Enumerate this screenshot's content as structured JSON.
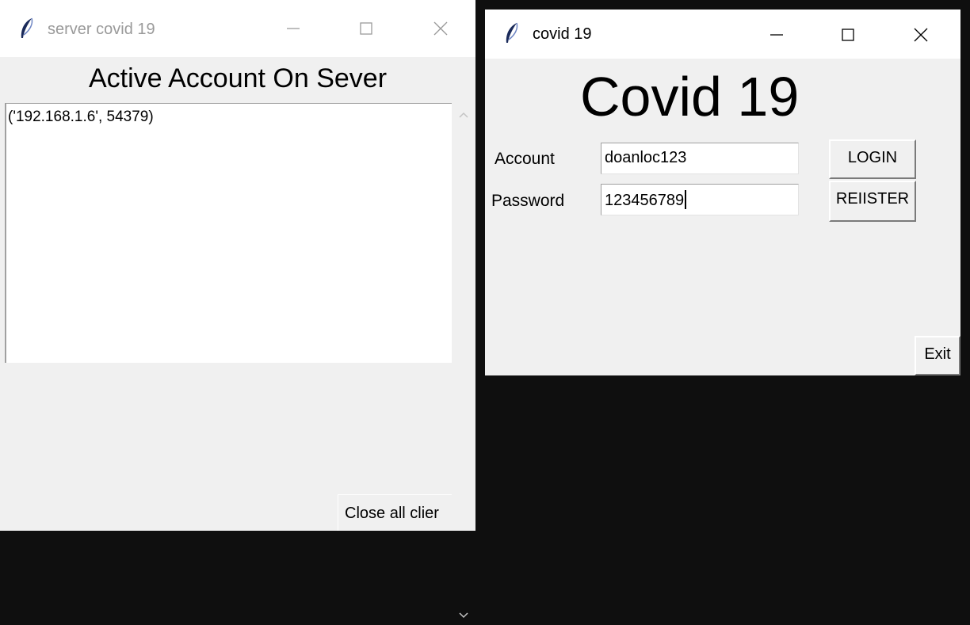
{
  "server_window": {
    "title": "server covid 19",
    "heading": "Active Account On Sever",
    "clients": [
      "('192.168.1.6', 54379)"
    ],
    "close_all_label": "Close all clier"
  },
  "client_window": {
    "title": "covid 19",
    "heading": "Covid 19",
    "account_label": "Account",
    "account_value": "doanloc123",
    "password_label": "Password",
    "password_value": "123456789",
    "login_label": "LOGIN",
    "register_label": "REIISTER",
    "exit_label": "Exit"
  },
  "icons": {
    "app": "feather-icon",
    "minimize": "minimize-icon",
    "maximize": "maximize-icon",
    "close": "close-icon",
    "scroll_up": "chevron-up-icon",
    "scroll_down": "chevron-down-icon"
  }
}
